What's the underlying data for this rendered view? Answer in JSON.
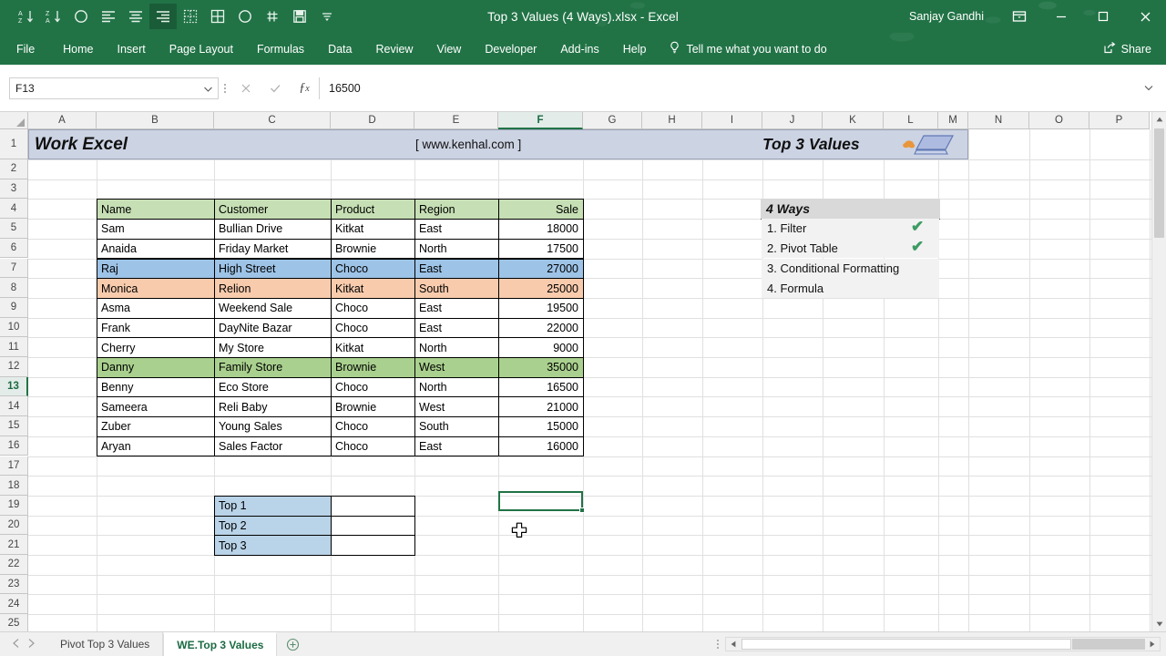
{
  "window": {
    "title": "Top 3 Values (4 Ways).xlsx  -  Excel",
    "user": "Sanjay Gandhi",
    "ribbon_display_icon": "ribbon-display-options-icon",
    "minimize_icon": "minimize-icon",
    "maximize_icon": "maximize-icon",
    "close_icon": "close-icon"
  },
  "quick_access": [
    {
      "name": "sort-az-icon",
      "label": "Sort A to Z"
    },
    {
      "name": "sort-za-icon",
      "label": "Sort Z to A"
    },
    {
      "name": "circle-icon",
      "label": "Circle"
    },
    {
      "name": "align-left-icon",
      "label": "Align Left"
    },
    {
      "name": "align-center-icon",
      "label": "Center"
    },
    {
      "name": "align-right-icon",
      "label": "Align Right"
    },
    {
      "name": "borders-dashed-icon",
      "label": "Borders"
    },
    {
      "name": "all-borders-icon",
      "label": "All Borders"
    },
    {
      "name": "circle-outline-icon",
      "label": "Shape"
    },
    {
      "name": "pivot-icon",
      "label": "PivotTable"
    },
    {
      "name": "save-icon",
      "label": "Save"
    },
    {
      "name": "customize-qat-icon",
      "label": "Customize Quick Access Toolbar"
    }
  ],
  "ribbon_tabs": [
    "File",
    "Home",
    "Insert",
    "Page Layout",
    "Formulas",
    "Data",
    "Review",
    "View",
    "Developer",
    "Add-ins",
    "Help"
  ],
  "tell_me": "Tell me what you want to do",
  "share_label": "Share",
  "formula_bar": {
    "name_box": "F13",
    "cancel_icon": "cancel-icon",
    "enter_icon": "confirm-icon",
    "function_icon": "insert-function-icon",
    "formula_value": "16500"
  },
  "grid": {
    "columns": [
      "A",
      "B",
      "C",
      "D",
      "E",
      "F",
      "G",
      "H",
      "I",
      "J",
      "K",
      "L",
      "M",
      "N",
      "O",
      "P"
    ],
    "selected_column": "F",
    "rows": [
      1,
      2,
      3,
      4,
      5,
      6,
      7,
      8,
      9,
      10,
      11,
      12,
      13,
      14,
      15,
      16,
      17,
      18,
      19,
      20,
      21,
      22,
      23,
      24,
      25
    ],
    "selected_row": 13,
    "selected_cell": "F13"
  },
  "banner": {
    "title": "Work Excel",
    "url": "[  www.kenhal.com  ]",
    "right_title": "Top 3 Values",
    "art_icon": "laptop-icon"
  },
  "table": {
    "headers": [
      "Name",
      "Customer",
      "Product",
      "Region",
      "Sale"
    ],
    "rows": [
      {
        "row": 5,
        "name": "Sam",
        "customer": "Bullian Drive",
        "product": "Kitkat",
        "region": "East",
        "sale": "18000",
        "fill": "none"
      },
      {
        "row": 6,
        "name": "Anaida",
        "customer": "Friday Market",
        "product": "Brownie",
        "region": "North",
        "sale": "17500",
        "fill": "none"
      },
      {
        "row": 7,
        "name": "Raj",
        "customer": "High Street",
        "product": "Choco",
        "region": "East",
        "sale": "27000",
        "fill": "blue"
      },
      {
        "row": 8,
        "name": "Monica",
        "customer": "Relion",
        "product": "Kitkat",
        "region": "South",
        "sale": "25000",
        "fill": "orange"
      },
      {
        "row": 9,
        "name": "Asma",
        "customer": "Weekend Sale",
        "product": "Choco",
        "region": "East",
        "sale": "19500",
        "fill": "none"
      },
      {
        "row": 10,
        "name": "Frank",
        "customer": "DayNite Bazar",
        "product": "Choco",
        "region": "East",
        "sale": "22000",
        "fill": "none"
      },
      {
        "row": 11,
        "name": "Cherry",
        "customer": "My Store",
        "product": "Kitkat",
        "region": "North",
        "sale": "9000",
        "fill": "none"
      },
      {
        "row": 12,
        "name": "Danny",
        "customer": "Family Store",
        "product": "Brownie",
        "region": "West",
        "sale": "35000",
        "fill": "green"
      },
      {
        "row": 13,
        "name": "Benny",
        "customer": "Eco Store",
        "product": "Choco",
        "region": "North",
        "sale": "16500",
        "fill": "none"
      },
      {
        "row": 14,
        "name": "Sameera",
        "customer": "Reli Baby",
        "product": "Brownie",
        "region": "West",
        "sale": "21000",
        "fill": "none"
      },
      {
        "row": 15,
        "name": "Zuber",
        "customer": "Young Sales",
        "product": "Choco",
        "region": "South",
        "sale": "15000",
        "fill": "none"
      },
      {
        "row": 16,
        "name": "Aryan",
        "customer": "Sales Factor",
        "product": "Choco",
        "region": "East",
        "sale": "16000",
        "fill": "none"
      }
    ]
  },
  "ways_box": {
    "title": "4 Ways",
    "items": [
      {
        "label": "1. Filter",
        "checked": true
      },
      {
        "label": "2. Pivot Table",
        "checked": true
      },
      {
        "label": "3. Conditional Formatting",
        "checked": false
      },
      {
        "label": "4. Formula",
        "checked": false
      }
    ],
    "check_icon": "check-icon",
    "check_color": "#3d9b63"
  },
  "top_list": [
    {
      "label": "Top 1",
      "value": ""
    },
    {
      "label": "Top 2",
      "value": ""
    },
    {
      "label": "Top 3",
      "value": ""
    }
  ],
  "sheet_tabs": [
    {
      "label": "Pivot Top 3 Values",
      "active": false
    },
    {
      "label": "WE.Top 3 Values",
      "active": true
    }
  ],
  "add_sheet_icon": "add-sheet-icon",
  "colors": {
    "brand_green": "#217346",
    "header_fill": "#c6dfb4",
    "blue_fill": "#9dc3e6",
    "orange_fill": "#f8cbad",
    "green_fill": "#a9d08e",
    "banner_fill": "#ccd3e3",
    "top_label_fill": "#b9d3e8"
  }
}
